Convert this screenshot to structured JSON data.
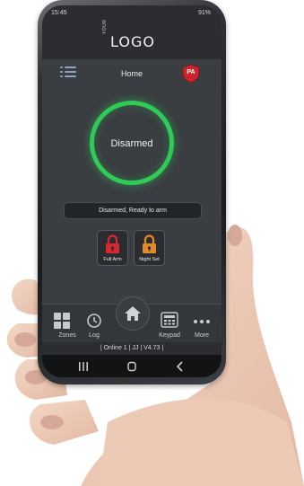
{
  "statusbar": {
    "time": "15:45",
    "battery": "91%"
  },
  "branding": {
    "logo_your": "YOUR",
    "logo_text": "LOGO"
  },
  "header": {
    "title": "Home",
    "pa_label": "PA"
  },
  "status": {
    "ring_label": "Disarmed",
    "message": "Disarmed, Ready to arm"
  },
  "arm_buttons": [
    {
      "label": "Full Arm",
      "icon": "padlock-icon",
      "color": "#d8282f"
    },
    {
      "label": "Night Set",
      "icon": "padlock-icon",
      "color": "#e08a2a"
    }
  ],
  "nav": {
    "items": [
      {
        "label": "Zones",
        "icon": "grid-icon"
      },
      {
        "label": "Log",
        "icon": "history-icon"
      },
      {
        "label": "",
        "icon": "home-icon"
      },
      {
        "label": "Keypad",
        "icon": "keypad-icon"
      },
      {
        "label": "More",
        "icon": "more-icon"
      }
    ]
  },
  "footer": {
    "info": "| Online 1 | JJ | V4.73 |"
  },
  "colors": {
    "accent_green": "#2ecc57",
    "danger_red": "#d8282f",
    "warning_orange": "#e08a2a"
  }
}
